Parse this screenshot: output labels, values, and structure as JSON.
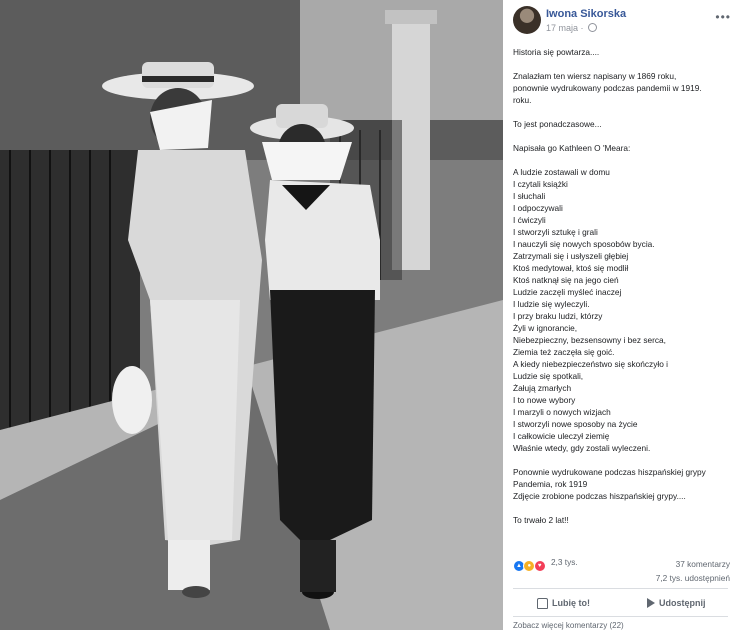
{
  "photo": {
    "alt": ""
  },
  "post": {
    "author": "Iwona Sikorska",
    "date": "17 maja",
    "date_separator": "·",
    "more_icon": "more-dots-icon",
    "lines": [
      "Historia się powtarza....",
      "",
      "Znalazłam ten wiersz napisany w 1869 roku,",
      "ponownie wydrukowany podczas pandemii w 1919.",
      "roku.",
      "",
      "To jest ponadczasowe...",
      "",
      "Napisała go Kathleen O 'Meara:",
      "",
      "A ludzie zostawali w domu",
      "I czytali książki",
      "I słuchali",
      "I odpoczywali",
      "I ćwiczyli",
      "I stworzyli sztukę i grali",
      "I nauczyli się nowych sposobów bycia.",
      "Zatrzymali się i usłyszeli głębiej",
      "Ktoś medytował, ktoś się modlił",
      "Ktoś natknął się na jego cień",
      "Ludzie zaczęli myśleć inaczej",
      "I ludzie się wyleczyli.",
      "I przy braku ludzi, którzy",
      "Żyli w ignorancie,",
      "Niebezpieczny, bezsensowny i bez serca,",
      "Ziemia też zaczęła się goić.",
      "A kiedy niebezpieczeństwo się skończyło i",
      "Ludzie się spotkali,",
      "Żałują zmarłych",
      "I to nowe wybory",
      "I marzyli o nowych wizjach",
      "I stworzyli nowe sposoby na życie",
      "I całkowicie uleczył ziemię",
      "Właśnie wtedy, gdy zostali wyleczeni.",
      "",
      "Ponownie wydrukowane podczas hiszpańskiej grypy",
      "Pandemia, rok 1919",
      "Zdjęcie zrobione podczas hiszpańskiej grypy....",
      "",
      "To trwało 2 lat!!"
    ],
    "reaction_count": "2,3 tys.",
    "reaction_icons": [
      "like-icon",
      "wow-icon",
      "love-icon"
    ],
    "comments_count": "37 komentarzy",
    "shares_count": "7,2 tys. udostępnień",
    "like_label": "Lubię to!",
    "share_label": "Udostępnij",
    "more_comments_label": "Zobacz więcej komentarzy (22)"
  }
}
